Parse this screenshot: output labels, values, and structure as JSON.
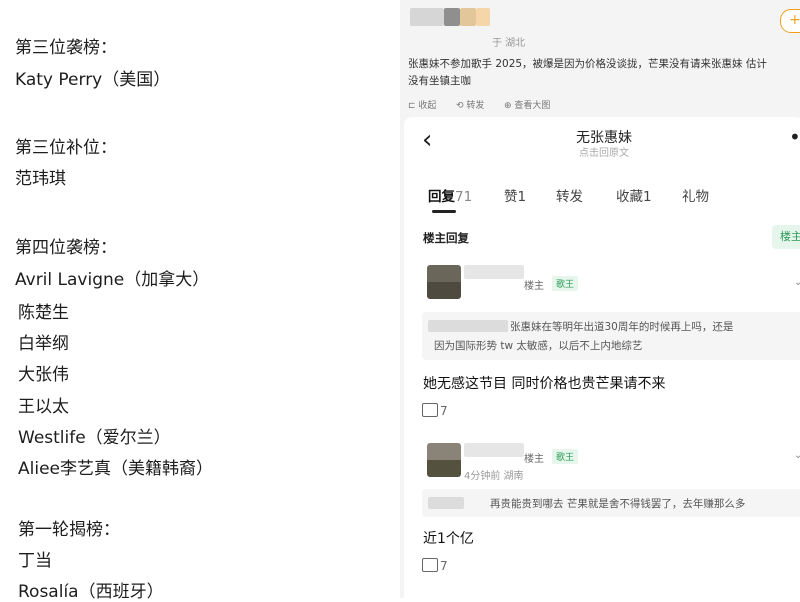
{
  "left_list": {
    "lines": [
      "第三位袭榜：",
      "Katy Perry（美国）",
      "第三位补位：",
      "范玮琪",
      "第四位袭榜：",
      "Avril Lavigne（加拿大）",
      "陈楚生",
      "白举纲",
      "大张伟",
      "王以太",
      "Westlife（爱尔兰）",
      "Aliee李艺真（美籍韩裔）",
      "第一轮揭榜：",
      "丁当",
      "Rosalía（西班牙）"
    ]
  },
  "post": {
    "follow_label": "+",
    "location": "于 湖北",
    "text_line1": "张惠妹不参加歌手 2025，被爆是因为价格没谈拢，芒果没有请来张惠妹 估计",
    "text_line2": "没有坐镇主咖",
    "actions": [
      "收起",
      "转发",
      "查看大图"
    ]
  },
  "thread": {
    "back_icon": "‹",
    "title": "无张惠妹",
    "subtitle": "点击回原文",
    "more_icon": "••",
    "tabs": [
      {
        "label": "回复",
        "count": "71"
      },
      {
        "label": "赞",
        "count": "1"
      },
      {
        "label": "转发",
        "count": ""
      },
      {
        "label": "收藏",
        "count": "1"
      },
      {
        "label": "礼物",
        "count": ""
      }
    ],
    "section_title": "楼主回复",
    "section_button": "楼主",
    "replies": [
      {
        "role": "楼主",
        "badge": "歌王",
        "meta": "",
        "quote_line1": "张惠妹在等明年出道30周年的时候再上吗，还是",
        "quote_line2": "因为国际形势 tw 太敏感，以后不上内地综艺",
        "text": "她无感这节目 同时价格也贵芒果请不来",
        "likes": "7"
      },
      {
        "role": "楼主",
        "badge": "歌王",
        "meta": "4分钟前 湖南",
        "quote_line1": "再贵能贵到哪去 芒果就是舍不得钱罢了，去年赚那么多",
        "quote_line2": "",
        "text": "近1个亿",
        "likes": "7"
      }
    ]
  }
}
